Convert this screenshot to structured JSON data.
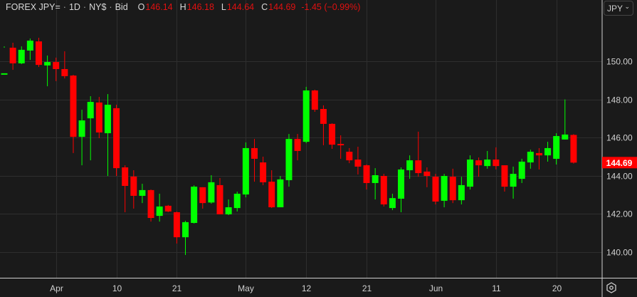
{
  "header": {
    "symbol": "FOREX JPY=",
    "interval": "1D",
    "session": "NY$",
    "price_type": "Bid",
    "o_label": "O",
    "open": "146.14",
    "h_label": "H",
    "high": "146.18",
    "l_label": "L",
    "low": "144.64",
    "c_label": "C",
    "close": "144.69",
    "change": "-1.45 (−0.99%)",
    "separator": "·"
  },
  "currency_selector": {
    "value": "JPY",
    "icon": "chevron-down-icon"
  },
  "settings": {
    "icon": "settings-hexagon-icon"
  },
  "colors": {
    "up": "#00ff00",
    "down": "#ff0000",
    "bg": "#1a1a1a",
    "grid": "#2e2e2e",
    "axis": "#d0d0d0"
  },
  "chart_data": {
    "type": "candlestick",
    "title": "FOREX JPY= 1D NY$ Bid",
    "ylim": [
      138.7,
      151.8
    ],
    "y_ticks": [
      "140.00",
      "142.00",
      "144.00",
      "146.00",
      "148.00",
      "150.00"
    ],
    "y_tick_values": [
      140,
      142,
      144,
      146,
      148,
      150
    ],
    "x_ticks": [
      {
        "label": "Apr",
        "index": 6
      },
      {
        "label": "10",
        "index": 13
      },
      {
        "label": "21",
        "index": 20
      },
      {
        "label": "May",
        "index": 28
      },
      {
        "label": "12",
        "index": 35
      },
      {
        "label": "21",
        "index": 42
      },
      {
        "label": "Jun",
        "index": 50
      },
      {
        "label": "11",
        "index": 57
      },
      {
        "label": "20",
        "index": 64
      }
    ],
    "last_price": "144.69",
    "ohlc": [
      [
        149.37,
        150.71,
        150.78,
        149.37
      ],
      [
        150.71,
        150.97,
        149.55,
        149.89
      ],
      [
        149.89,
        150.78,
        149.85,
        150.6
      ],
      [
        150.56,
        151.19,
        150.07,
        151.08
      ],
      [
        151.04,
        151.23,
        149.7,
        149.81
      ],
      [
        149.78,
        150.3,
        148.69,
        149.96
      ],
      [
        149.96,
        150.19,
        148.96,
        149.59
      ],
      [
        149.59,
        150.52,
        149.1,
        149.22
      ],
      [
        149.25,
        149.29,
        145.19,
        146.04
      ],
      [
        146.04,
        147.46,
        144.55,
        146.9
      ],
      [
        147.01,
        148.17,
        144.81,
        147.87
      ],
      [
        147.84,
        148.13,
        145.97,
        146.27
      ],
      [
        146.23,
        148.28,
        143.99,
        147.72
      ],
      [
        147.54,
        147.72,
        143.99,
        144.4
      ],
      [
        144.44,
        144.55,
        142.09,
        143.47
      ],
      [
        143.96,
        144.29,
        142.28,
        142.95
      ],
      [
        142.95,
        143.58,
        142.57,
        143.25
      ],
      [
        143.25,
        143.28,
        141.6,
        141.79
      ],
      [
        141.9,
        143.06,
        141.6,
        142.39
      ],
      [
        142.43,
        142.47,
        142.1,
        142.13
      ],
      [
        142.09,
        142.13,
        140.45,
        140.78
      ],
      [
        140.78,
        141.64,
        139.85,
        141.57
      ],
      [
        141.53,
        143.5,
        141.5,
        143.43
      ],
      [
        143.4,
        143.4,
        142.28,
        142.57
      ],
      [
        142.6,
        144.03,
        142.54,
        143.66
      ],
      [
        143.51,
        143.88,
        141.98,
        141.98
      ],
      [
        141.98,
        142.76,
        141.94,
        142.35
      ],
      [
        142.31,
        143.17,
        142.13,
        143.06
      ],
      [
        143.02,
        145.75,
        142.87,
        145.45
      ],
      [
        145.45,
        145.93,
        143.69,
        144.89
      ],
      [
        144.7,
        145.0,
        143.51,
        143.66
      ],
      [
        143.69,
        144.29,
        142.31,
        142.35
      ],
      [
        142.35,
        143.99,
        142.35,
        143.81
      ],
      [
        143.77,
        146.19,
        143.43,
        145.93
      ],
      [
        145.93,
        146.19,
        144.81,
        145.3
      ],
      [
        145.78,
        148.66,
        145.71,
        148.47
      ],
      [
        148.47,
        148.51,
        147.35,
        147.46
      ],
      [
        147.5,
        147.69,
        145.6,
        146.72
      ],
      [
        146.72,
        146.75,
        145.41,
        145.63
      ],
      [
        145.67,
        146.12,
        144.89,
        145.6
      ],
      [
        145.26,
        145.45,
        144.66,
        144.81
      ],
      [
        144.85,
        145.52,
        144.07,
        144.48
      ],
      [
        144.55,
        144.59,
        143.28,
        143.62
      ],
      [
        143.62,
        144.4,
        142.76,
        144.03
      ],
      [
        143.99,
        144.1,
        142.39,
        142.5
      ],
      [
        142.31,
        143.06,
        142.2,
        142.83
      ],
      [
        142.8,
        144.44,
        142.09,
        144.33
      ],
      [
        144.29,
        145.07,
        143.84,
        144.81
      ],
      [
        144.81,
        146.31,
        143.95,
        144.14
      ],
      [
        144.22,
        144.44,
        143.4,
        143.99
      ],
      [
        143.95,
        144.1,
        142.5,
        142.65
      ],
      [
        142.69,
        144.1,
        142.35,
        143.99
      ],
      [
        143.95,
        144.37,
        142.57,
        142.72
      ],
      [
        142.72,
        143.95,
        142.5,
        143.51
      ],
      [
        143.43,
        145.07,
        143.28,
        144.85
      ],
      [
        144.81,
        144.96,
        143.95,
        144.55
      ],
      [
        144.51,
        145.3,
        144.37,
        144.85
      ],
      [
        144.85,
        145.49,
        144.33,
        144.51
      ],
      [
        144.55,
        144.55,
        143.17,
        143.43
      ],
      [
        143.43,
        144.48,
        142.8,
        144.1
      ],
      [
        143.84,
        144.89,
        143.62,
        144.74
      ],
      [
        144.7,
        145.37,
        144.37,
        145.26
      ],
      [
        145.19,
        145.45,
        144.33,
        145.07
      ],
      [
        145.07,
        145.78,
        144.74,
        145.45
      ],
      [
        144.89,
        146.23,
        144.59,
        146.08
      ],
      [
        145.9,
        148.0,
        145.9,
        146.16
      ],
      [
        146.14,
        146.18,
        144.64,
        144.69
      ]
    ]
  }
}
